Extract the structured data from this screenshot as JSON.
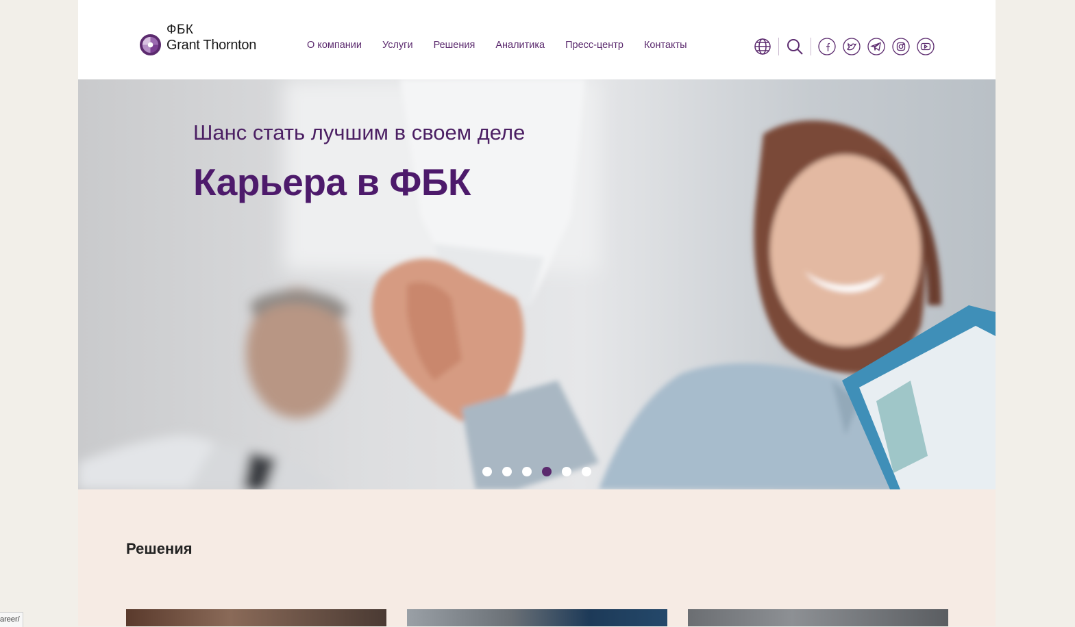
{
  "header": {
    "logo": {
      "line1": "ФБК",
      "line2": "Grant Thornton"
    },
    "nav": [
      {
        "label": "О компании"
      },
      {
        "label": "Услуги"
      },
      {
        "label": "Решения"
      },
      {
        "label": "Аналитика"
      },
      {
        "label": "Пресс-центр"
      },
      {
        "label": "Контакты"
      }
    ],
    "tools": {
      "language_icon": "globe-icon",
      "search_icon": "search-icon"
    },
    "social": [
      "facebook-icon",
      "twitter-icon",
      "telegram-icon",
      "instagram-icon",
      "youtube-icon"
    ]
  },
  "hero": {
    "subtitle": "Шанс стать лучшим в своем деле",
    "title": "Карьера в ФБК",
    "slides_count": 6,
    "active_slide": 4
  },
  "solutions": {
    "title": "Решения"
  },
  "status": {
    "url_fragment": "areer/"
  },
  "colors": {
    "brand_purple": "#5b2a6e",
    "hero_title": "#4d1a6b",
    "section_bg": "#f6ebe4",
    "outer_bg": "#f2efe9"
  }
}
